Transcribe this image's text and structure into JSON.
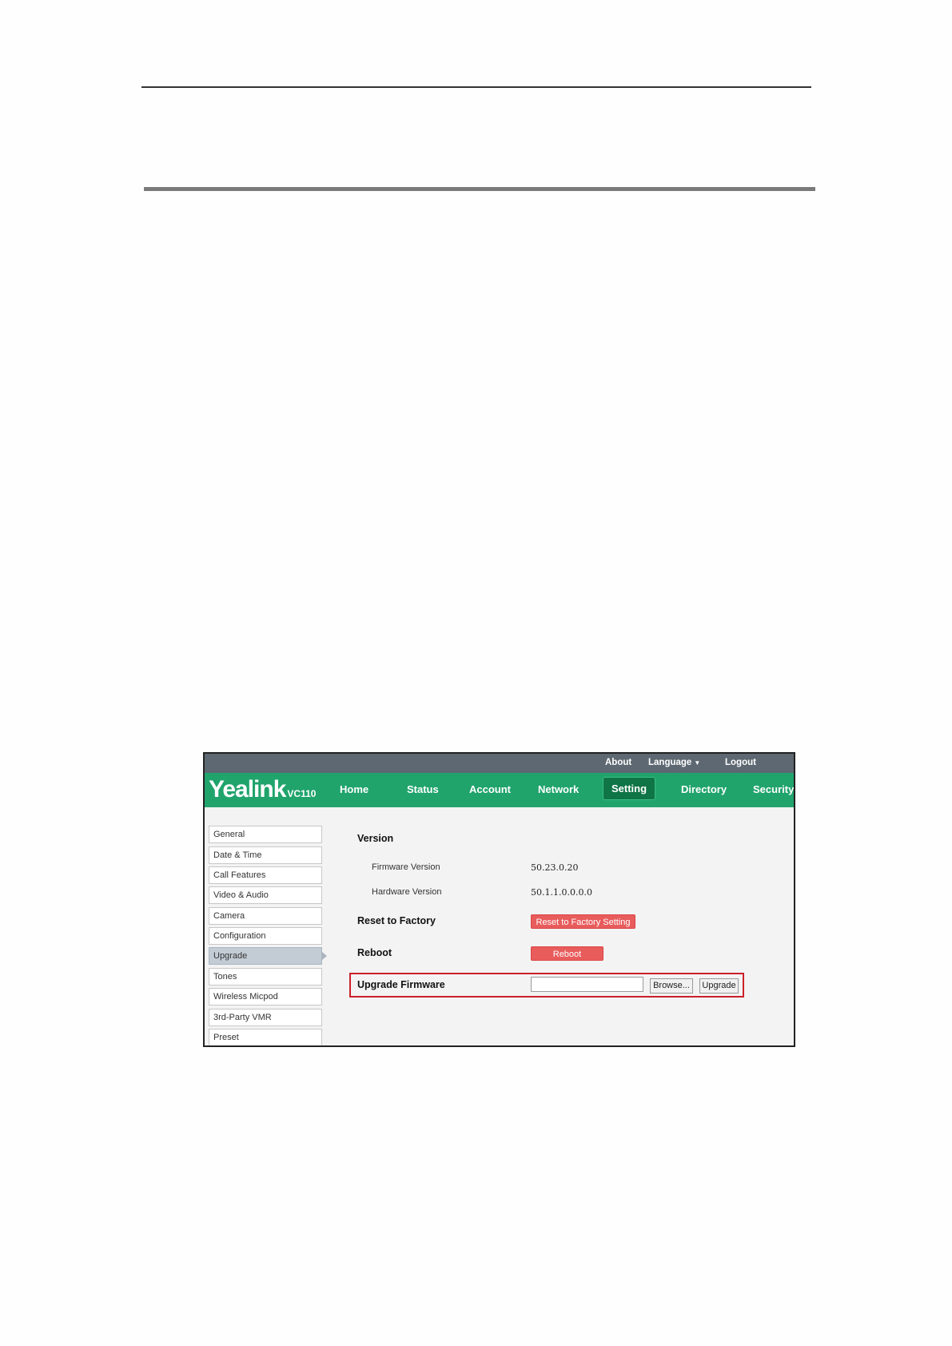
{
  "topbar": {
    "about": "About",
    "language": "Language",
    "logout": "Logout"
  },
  "logo": {
    "brand": "Yealink",
    "model": "VC110"
  },
  "nav": {
    "tabs": [
      "Home",
      "Status",
      "Account",
      "Network",
      "Setting",
      "Directory",
      "Security"
    ],
    "active": "Setting"
  },
  "sidebar": {
    "items": [
      "General",
      "Date & Time",
      "Call Features",
      "Video & Audio",
      "Camera",
      "Configuration",
      "Upgrade",
      "Tones",
      "Wireless Micpod",
      "3rd-Party VMR",
      "Preset"
    ],
    "active": "Upgrade"
  },
  "content": {
    "version_heading": "Version",
    "firmware_label": "Firmware Version",
    "firmware_value": "50.23.0.20",
    "hardware_label": "Hardware Version",
    "hardware_value": "50.1.1.0.0.0.0",
    "reset_label": "Reset to Factory",
    "reset_button": "Reset to Factory Setting",
    "reboot_label": "Reboot",
    "reboot_button": "Reboot",
    "upgrade_label": "Upgrade Firmware",
    "browse_button": "Browse...",
    "upgrade_button": "Upgrade"
  },
  "colors": {
    "nav_green": "#20a46c",
    "active_tab": "#0f7446",
    "topbar": "#5d6872",
    "danger_button": "#e85c5c",
    "highlight_border": "#cc1f2a"
  }
}
